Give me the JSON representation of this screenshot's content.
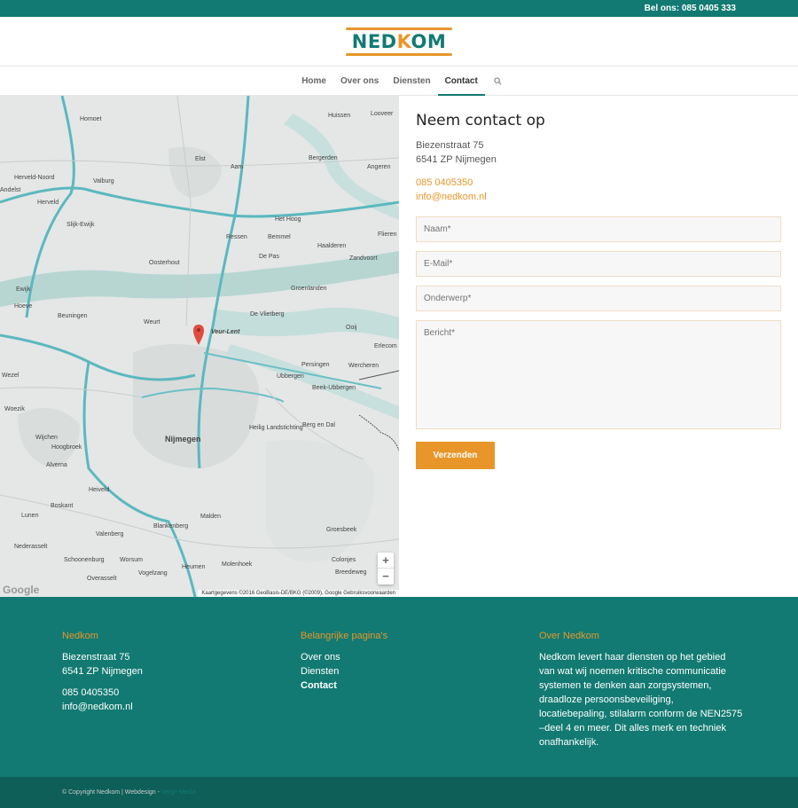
{
  "topbar": {
    "phone_label": "Bel ons: 085 0405 333"
  },
  "logo": {
    "text_left": "NED",
    "text_k": "K",
    "text_right": "OM"
  },
  "nav": {
    "items": [
      {
        "label": "Home"
      },
      {
        "label": "Over ons"
      },
      {
        "label": "Diensten"
      },
      {
        "label": "Contact"
      }
    ],
    "search_icon": "search-icon"
  },
  "map": {
    "labels": {
      "homoet": "Homoet",
      "huissen": "Huissen",
      "looveer": "Looveer",
      "elst": "Elst",
      "bergerden": "Bergerden",
      "aam": "Aam",
      "angeren": "Angeren",
      "herveld_noord": "Herveld-Noord",
      "valburg": "Valburg",
      "andelst": "Andelst",
      "herveld": "Herveld",
      "het_hoog": "Het Hoog",
      "slijk_ewijk": "Slijk-Ewijk",
      "oosterhout": "Oosterhout",
      "ressen": "Ressen",
      "bemmel": "Bemmel",
      "haalderen": "Haalderen",
      "zandvoort": "Zandvoort",
      "fleuren": "Flieren",
      "de_pas": "De Pas",
      "ewijk": "Ewijk",
      "groenlanden": "Groenlanden",
      "hoeve": "Hoeve",
      "beuningen": "Beuningen",
      "weurt": "Weurt",
      "de_vlietberg": "De Vlietberg",
      "ooij": "Ooij",
      "veur_lent": "Veur-Lent",
      "erlecom": "Erlecom",
      "persingen": "Persingen",
      "wercheren": "Wercheren",
      "wezel": "Wezel",
      "ubbergen": "Ubbergen",
      "beek_ubbergen": "Beek-Ubbergen",
      "woezik": "Woezik",
      "wijchen": "Wijchen",
      "hoogbroek": "Hoogbroek",
      "nijmegen": "Nijmegen",
      "heilig_landstichting": "Heilig\nLandstichting",
      "berg_en_dal": "Berg en Dal",
      "alverna": "Alverna",
      "heiveld": "Heiveld",
      "boskant": "Boskant",
      "lunen": "Lunen",
      "malden": "Malden",
      "valenberg": "Valenberg",
      "blankenberg": "Blankenberg",
      "groesbeek": "Groesbeek",
      "nederasselt": "Nederasselt",
      "schoonenburg": "Schoonenburg",
      "worsum": "Worsum",
      "heumen": "Heumen",
      "molenhoek": "Molenhoek",
      "colonjes": "Colonjes",
      "overasselt": "Overasselt",
      "vogelzang": "Vogelzang",
      "breedeweg": "Breedeweg"
    },
    "zoom_in": "+",
    "zoom_out": "−",
    "google_label": "Google",
    "attribution": "Kaartgegevens ©2016 GeoBasis-DE/BKG (©2009), Google   Gebruiksvoorwaarden"
  },
  "contact": {
    "title": "Neem contact  op",
    "street": "Biezenstraat 75",
    "city": "6541 ZP Nijmegen",
    "phone": "085 0405350",
    "email": "info@nedkom.nl",
    "form": {
      "name_placeholder": "Naam*",
      "email_placeholder": "E-Mail*",
      "subject_placeholder": "Onderwerp*",
      "message_placeholder": "Bericht*",
      "submit_label": "Verzenden"
    }
  },
  "footer": {
    "col1": {
      "title": "Nedkom",
      "street": "Biezenstraat 75",
      "city": "6541 ZP Nijmegen",
      "phone": "085 0405350",
      "email": "info@nedkom.nl"
    },
    "col2": {
      "title": "Belangrijke pagina's",
      "links": [
        {
          "label": "Over ons"
        },
        {
          "label": "Diensten"
        },
        {
          "label": "Contact"
        }
      ]
    },
    "col3": {
      "title": "Over Nedkom",
      "text": "Nedkom levert haar diensten op het gebied van wat wij noemen kritische communicatie systemen te denken aan zorgsystemen, draadloze persoonsbeveiliging, locatiebepaling, stilalarm conform de NEN2575 –deel 4 en meer. Dit alles merk en techniek onafhankelijk."
    }
  },
  "copyright": {
    "text": "© Copyright Nedkom | Webdesign - ",
    "link": "Verge Media"
  }
}
